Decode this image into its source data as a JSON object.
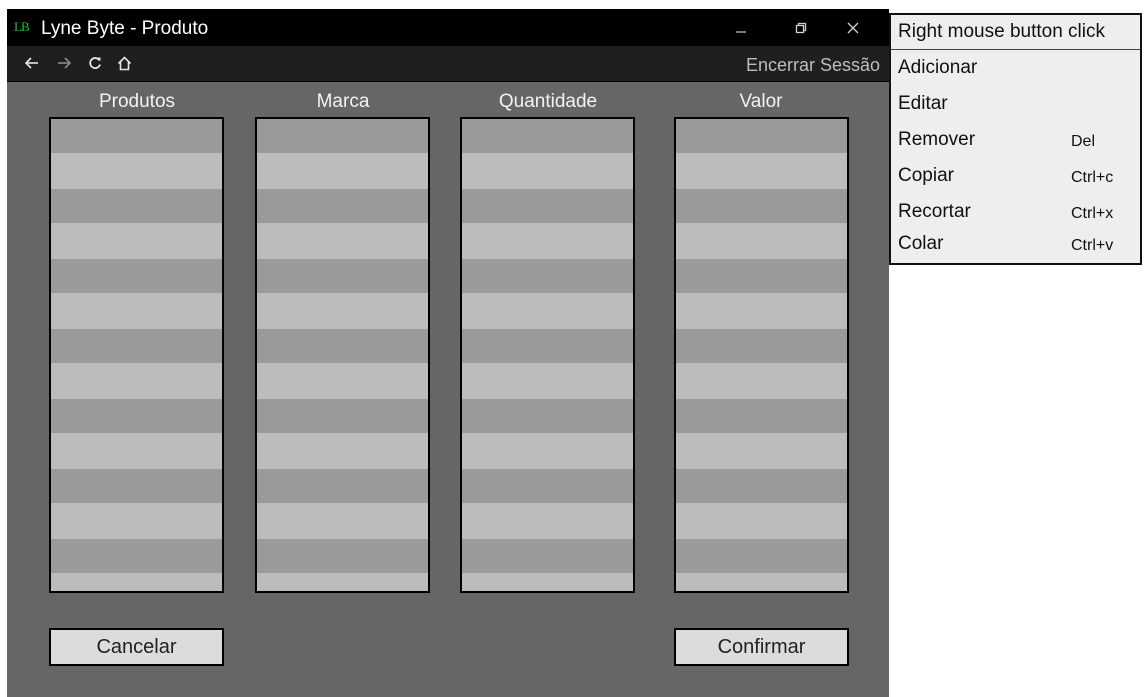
{
  "window": {
    "logo": "LB",
    "title": "Lyne Byte - Produto"
  },
  "nav": {
    "logout_label": "Encerrar Sessão"
  },
  "columns": [
    "Produtos",
    "Marca",
    "Quantidade",
    "Valor"
  ],
  "buttons": {
    "cancel": "Cancelar",
    "confirm": "Confirmar"
  },
  "context_menu": {
    "header": "Right mouse button click",
    "items": [
      {
        "label": "Adicionar",
        "shortcut": ""
      },
      {
        "label": "Editar",
        "shortcut": ""
      },
      {
        "label": "Remover",
        "shortcut": "Del"
      },
      {
        "label": "Copiar",
        "shortcut": "Ctrl+c"
      },
      {
        "label": "Recortar",
        "shortcut": "Ctrl+x"
      },
      {
        "label": "Colar",
        "shortcut": "Ctrl+v"
      }
    ]
  },
  "colors": {
    "background": "#666666",
    "titlebar": "#000000",
    "logo": "#1fbf3f",
    "row_dark": "#9a9a9a",
    "row_light": "#bcbcbc"
  }
}
